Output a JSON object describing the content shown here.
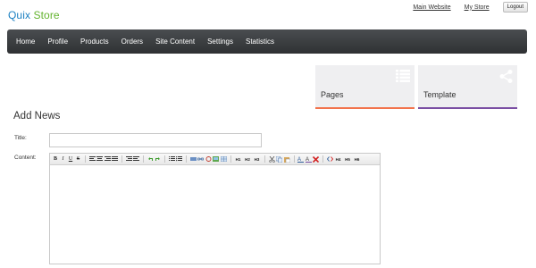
{
  "brand": {
    "part1": "Quix",
    "part2": " Store"
  },
  "top_links": {
    "main_website": "Main Website",
    "my_store": "My Store",
    "logout": "Logout"
  },
  "nav": {
    "items": [
      {
        "label": "Home"
      },
      {
        "label": "Profile"
      },
      {
        "label": "Products"
      },
      {
        "label": "Orders"
      },
      {
        "label": "Site Content"
      },
      {
        "label": "Settings"
      },
      {
        "label": "Statistics"
      }
    ]
  },
  "tiles": {
    "pages": {
      "label": "Pages",
      "icon": "list-icon",
      "accent": "#f2734c"
    },
    "template": {
      "label": "Template",
      "icon": "share-icon",
      "accent": "#7a4ea3"
    }
  },
  "form": {
    "heading": "Add News",
    "title_label": "Title:",
    "title_value": "",
    "content_label": "Content:"
  },
  "toolbar": {
    "bold": "B",
    "italic": "I",
    "underline": "U",
    "strike": "S",
    "h1": "H1",
    "h2": "H2",
    "h3": "H3",
    "para1": "H4",
    "para2": "H5",
    "para3": "H6"
  },
  "colors": {
    "brand_blue": "#1a7fc1",
    "brand_green": "#63b32e",
    "nav_bg": "#3a3c3e"
  }
}
